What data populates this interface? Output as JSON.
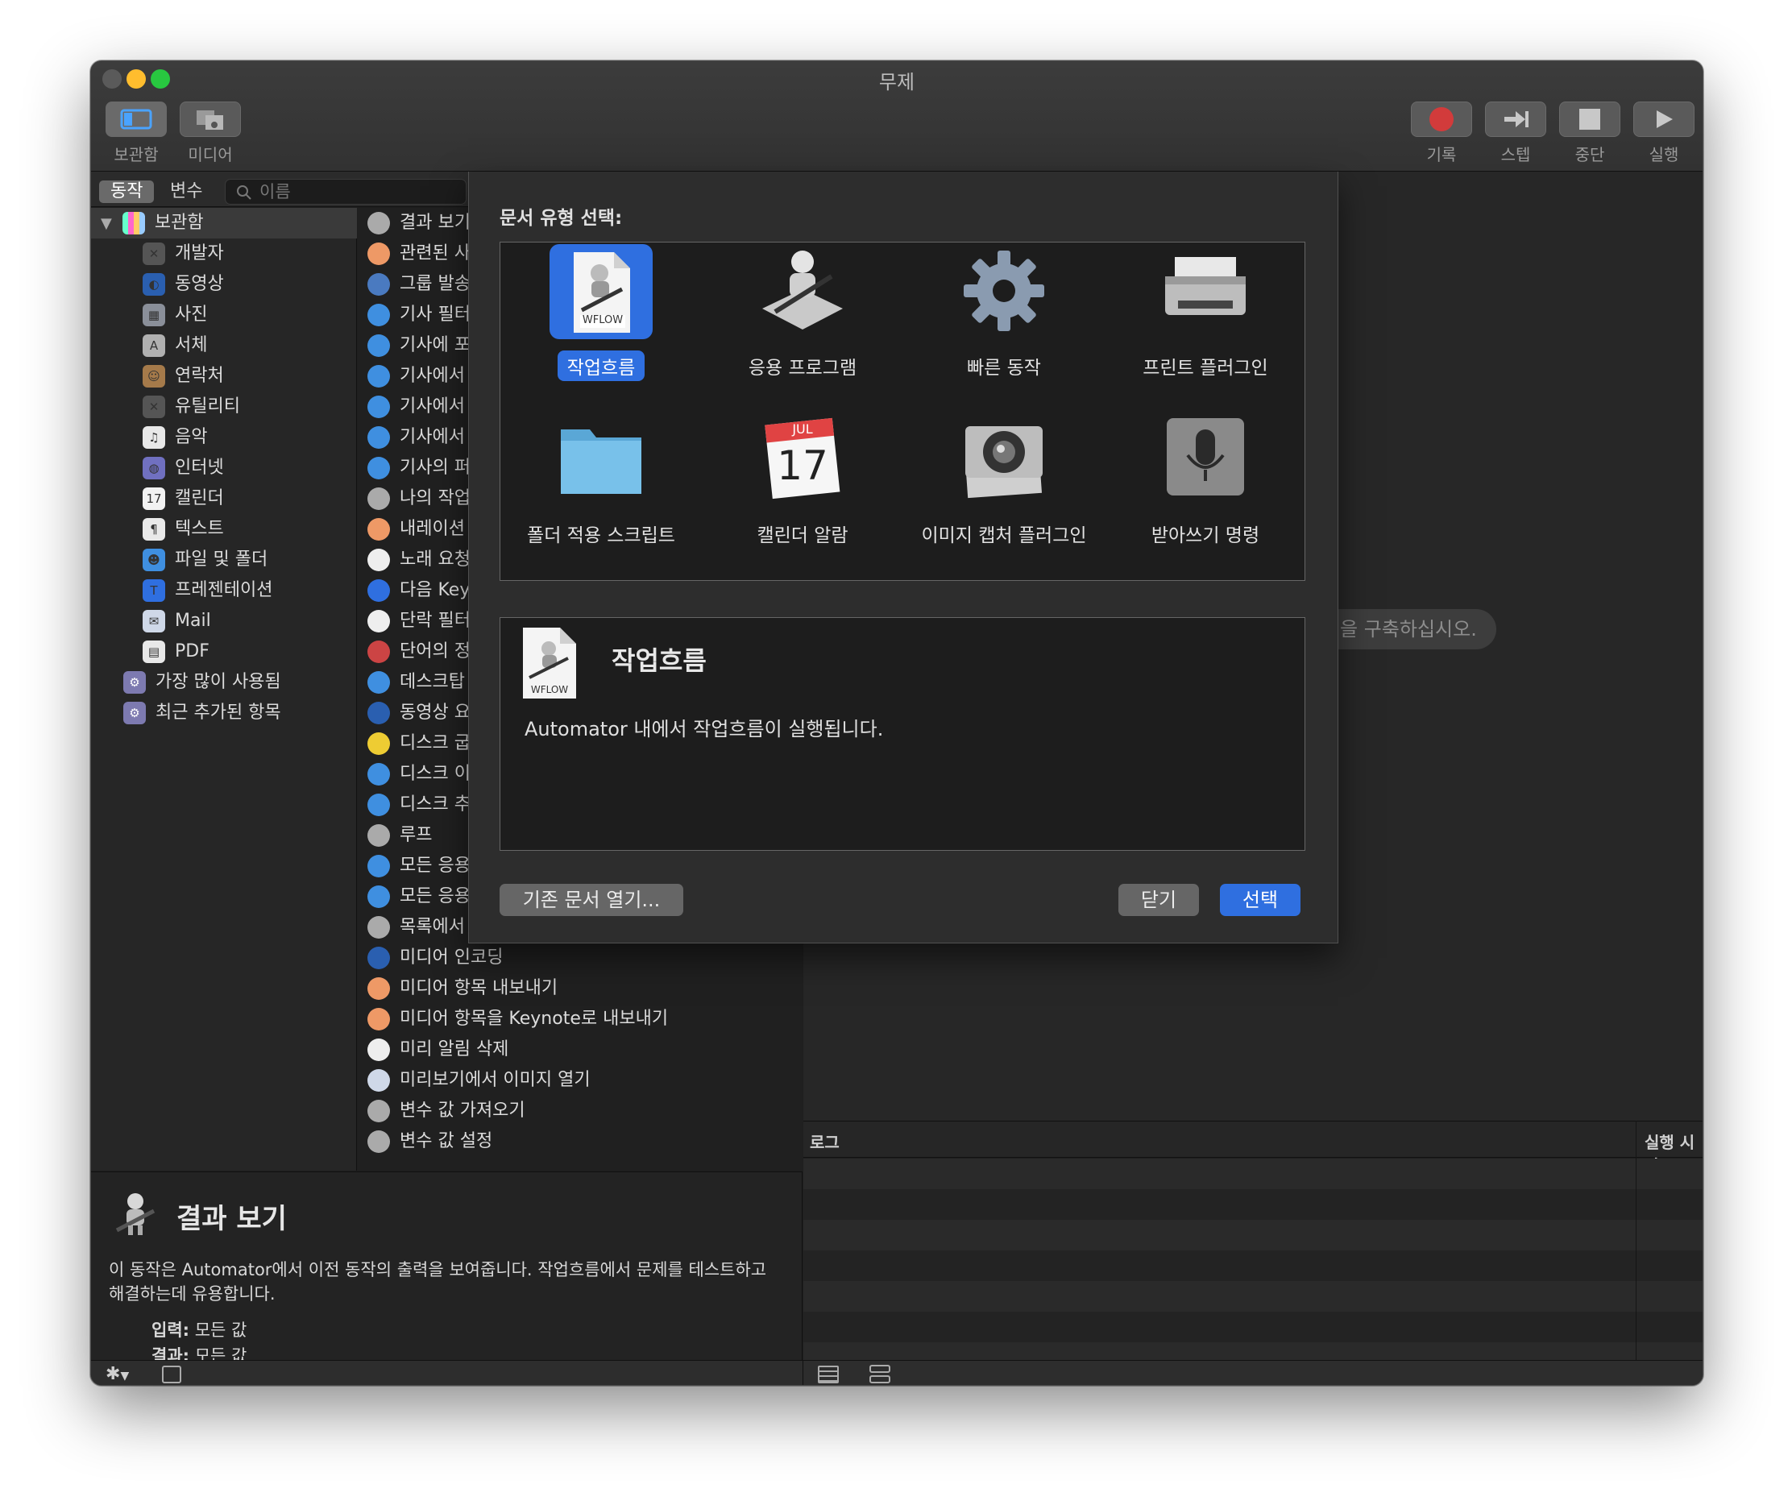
{
  "window": {
    "title": "무제",
    "lights": [
      "#5a5a5a",
      "#ffbd2e",
      "#28c840"
    ]
  },
  "toolbar": {
    "library_label": "보관함",
    "media_label": "미디어",
    "record_label": "기록",
    "step_label": "스텝",
    "stop_label": "중단",
    "run_label": "실행"
  },
  "library_header": {
    "actions_tab": "동작",
    "variables_tab": "변수",
    "search_placeholder": "이름"
  },
  "library": {
    "root": "보관함",
    "items": [
      {
        "label": "개발자",
        "icon": "developer-icon"
      },
      {
        "label": "동영상",
        "icon": "movie-icon"
      },
      {
        "label": "사진",
        "icon": "photo-icon"
      },
      {
        "label": "서체",
        "icon": "font-icon"
      },
      {
        "label": "연락처",
        "icon": "contacts-icon"
      },
      {
        "label": "유틸리티",
        "icon": "utilities-icon"
      },
      {
        "label": "음악",
        "icon": "music-icon"
      },
      {
        "label": "인터넷",
        "icon": "internet-icon"
      },
      {
        "label": "캘린더",
        "icon": "calendar-icon"
      },
      {
        "label": "텍스트",
        "icon": "text-icon"
      },
      {
        "label": "파일 및 폴더",
        "icon": "finder-icon"
      },
      {
        "label": "프레젠테이션",
        "icon": "presentation-icon"
      },
      {
        "label": "Mail",
        "icon": "mail-icon"
      },
      {
        "label": "PDF",
        "icon": "pdf-icon"
      }
    ],
    "smart_groups": [
      {
        "label": "가장 많이 사용됨",
        "icon": "smart-folder-icon"
      },
      {
        "label": "최근 추가된 항목",
        "icon": "smart-folder-icon"
      }
    ]
  },
  "actions": [
    "결과 보기",
    "관련된 사",
    "그룹 발송",
    "기사 필터",
    "기사에 포",
    "기사에서 ",
    "기사에서 ",
    "기사에서 ",
    "기사의 퍼",
    "나의 작업",
    "내레이션",
    "노래 요청",
    "다음 Key",
    "단락 필터",
    "단어의 정",
    "데스크탑 ",
    "동영상 요",
    "디스크 굽",
    "디스크 이",
    "디스크 추",
    "루프",
    "모든 응용",
    "모든 응용",
    "목록에서 ",
    "미디어 인코딩",
    "미디어 항목 내보내기",
    "미디어 항목을 Keynote로 내보내기",
    "미리 알림 삭제",
    "미리보기에서 이미지 열기",
    "변수 값 가져오기",
    "변수 값 설정"
  ],
  "description": {
    "title": "결과 보기",
    "body": "이 동작은 Automator에서 이전 동작의 출력을 보여줍니다. 작업흐름에서 문제를 테스트하고 해결하는데 유용합니다.",
    "input_label": "입력:",
    "input_value": "모든 값",
    "result_label": "결과:",
    "result_value": "모든 값"
  },
  "workflow_hint": "을 구축하십시오.",
  "log": {
    "col_log": "로그",
    "col_time": "실행 시간"
  },
  "sheet": {
    "title": "문서 유형 선택:",
    "types": [
      {
        "label": "작업흐름",
        "icon": "workflow-icon",
        "selected": true
      },
      {
        "label": "응용 프로그램",
        "icon": "application-icon",
        "selected": false
      },
      {
        "label": "빠른 동작",
        "icon": "gear-icon",
        "selected": false
      },
      {
        "label": "프린트 플러그인",
        "icon": "printer-icon",
        "selected": false
      },
      {
        "label": "폴더 적용 스크립트",
        "icon": "folder-icon",
        "selected": false
      },
      {
        "label": "캘린더 알람",
        "icon": "calendar-icon",
        "selected": false
      },
      {
        "label": "이미지 캡처 플러그인",
        "icon": "camera-icon",
        "selected": false
      },
      {
        "label": "받아쓰기 명령",
        "icon": "microphone-icon",
        "selected": false
      }
    ],
    "calendar_month": "JUL",
    "calendar_day": "17",
    "wflow_tag": "WFLOW",
    "info_title": "작업흐름",
    "info_body": "Automator 내에서 작업흐름이 실행됩니다.",
    "open_existing": "기존 문서 열기...",
    "close": "닫기",
    "choose": "선택"
  },
  "colors": {
    "accent": "#2f6fe0",
    "record": "#d23b3b"
  }
}
